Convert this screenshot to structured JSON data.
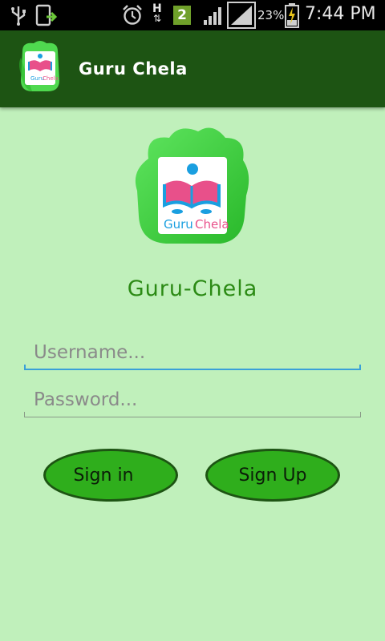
{
  "status_bar": {
    "network_type": "H",
    "notification_count": "2",
    "battery_percent": "23%",
    "time": "7:44 PM",
    "icons": [
      "usb-icon",
      "app-update-icon",
      "alarm-icon",
      "network-h-icon",
      "notification-badge-icon",
      "signal-icon",
      "signal-icon-2",
      "battery-charging-icon"
    ]
  },
  "action_bar": {
    "title": "Guru Chela"
  },
  "logo": {
    "brand_text_1": "Guru",
    "brand_text_2": "Chela"
  },
  "main": {
    "app_name": "Guru-Chela",
    "username_placeholder": "Username...",
    "password_placeholder": "Password...",
    "sign_in_label": "Sign in",
    "sign_up_label": "Sign Up"
  },
  "colors": {
    "background": "#c0f0bb",
    "action_bar": "#1d5413",
    "accent_green": "#2fae1c",
    "focused_underline": "#3aa0d8"
  }
}
